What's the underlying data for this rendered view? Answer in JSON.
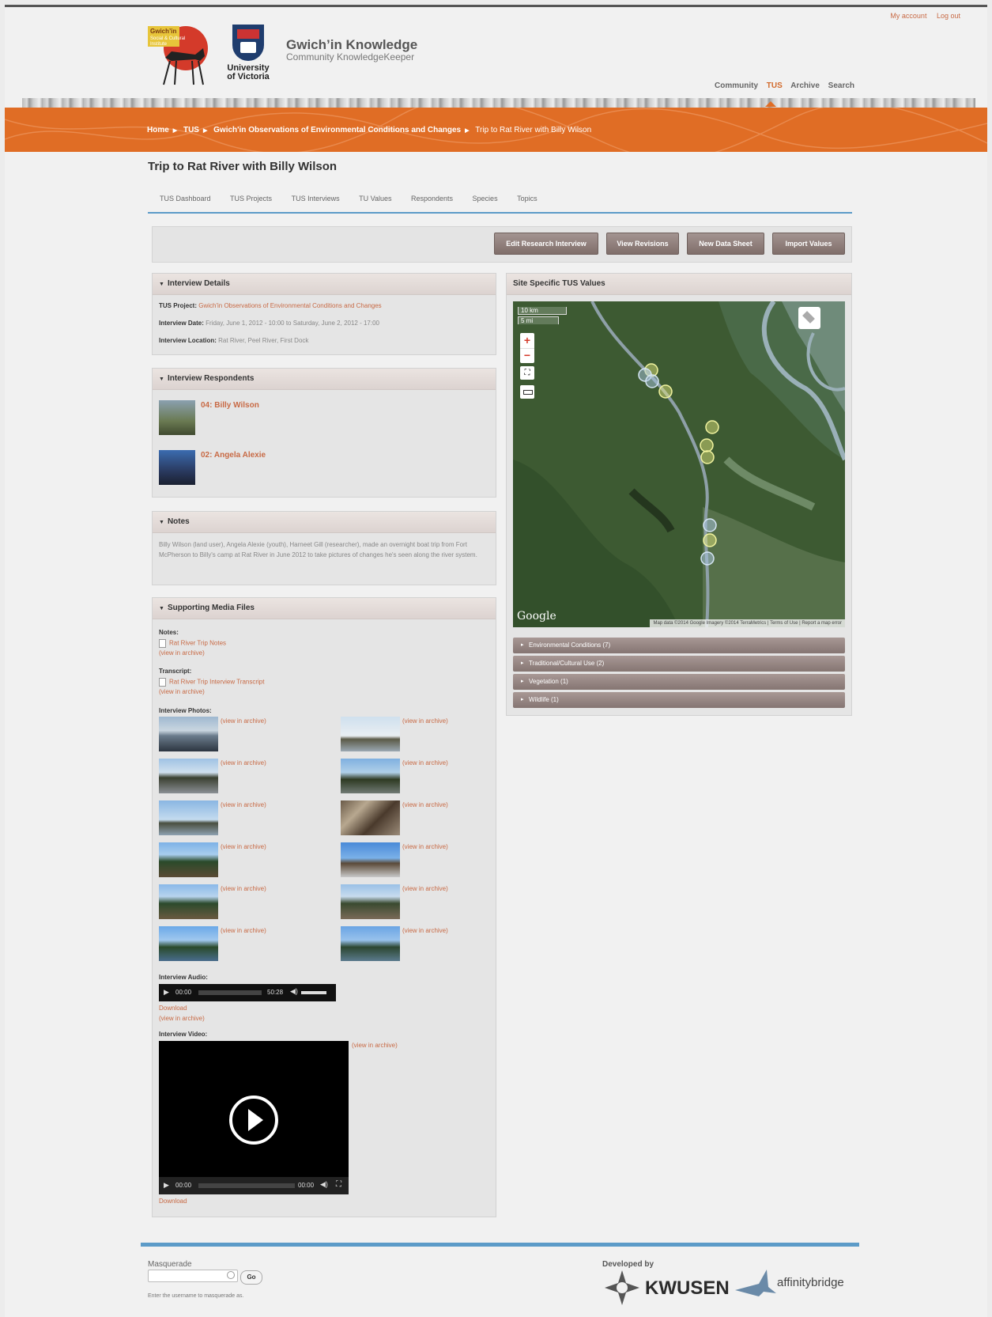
{
  "topbar": {
    "my_account": "My account",
    "log_out": "Log out"
  },
  "site": {
    "name": "Gwich’in Knowledge",
    "slogan": "Community KnowledgeKeeper",
    "uvic_line1": "University",
    "uvic_line2": "of Victoria",
    "logo_text_1": "Gwich’in",
    "logo_text_2": "Social & Cultural",
    "logo_text_3": "Institute"
  },
  "mainnav": [
    {
      "label": "Community"
    },
    {
      "label": "TUS"
    },
    {
      "label": "Archive"
    },
    {
      "label": "Search"
    }
  ],
  "breadcrumb": [
    "Home",
    "TUS",
    "Gwich'in Observations of Environmental Conditions and Changes",
    "Trip to Rat River with Billy Wilson"
  ],
  "page_title": "Trip to Rat River with Billy Wilson",
  "tabs": [
    "TUS Dashboard",
    "TUS Projects",
    "TUS Interviews",
    "TU Values",
    "Respondents",
    "Species",
    "Topics"
  ],
  "actions": [
    "Edit Research Interview",
    "View Revisions",
    "New Data Sheet",
    "Import Values"
  ],
  "interview_details": {
    "title": "Interview Details",
    "project_label": "TUS Project:",
    "project_value": "Gwich'in Observations of Environmental Conditions and Changes",
    "date_label": "Interview Date:",
    "date_value": "Friday, June 1, 2012 - 10:00 to Saturday, June 2, 2012 - 17:00",
    "location_label": "Interview Location:",
    "location_value": "Rat River, Peel River, First Dock"
  },
  "respondents": {
    "title": "Interview Respondents",
    "items": [
      "04: Billy Wilson",
      "02: Angela Alexie"
    ]
  },
  "notes": {
    "title": "Notes",
    "text": "Billy Wilson (land user), Angela Alexie (youth), Harneet Gill (researcher), made an overnight boat trip from Fort McPherson to Billy's camp at Rat River in June 2012 to take pictures of changes he's seen along the river system."
  },
  "media": {
    "title": "Supporting Media Files",
    "notes_label": "Notes:",
    "notes_file": "Rat River Trip Notes",
    "transcript_label": "Transcript:",
    "transcript_file": "Rat River Trip Interview Transcript",
    "view_in_archive": "(view in archive)",
    "photos_label": "Interview Photos:",
    "audio_label": "Interview Audio:",
    "audio_time": "00:00",
    "audio_duration": "50:28",
    "download": "Download",
    "video_label": "Interview Video:",
    "video_time": "00:00",
    "video_duration": "00:00"
  },
  "site_values": {
    "title": "Site Specific TUS Values",
    "scale_km": "10 km",
    "scale_mi": "5 mi",
    "google": "Google",
    "attribution": "Map data ©2014 Google Imagery ©2014 TerraMetrics",
    "terms": "Terms of Use",
    "report": "Report a map error",
    "categories": [
      "Environmental Conditions (7)",
      "Traditional/Cultural Use (2)",
      "Vegetation (1)",
      "Wildlife (1)"
    ]
  },
  "footer": {
    "masquerade_label": "Masquerade",
    "go": "Go",
    "masquerade_help": "Enter the username to masquerade as.",
    "developed_by": "Developed by",
    "kwusen": "KWUSEN",
    "affinity": "affinitybridge"
  },
  "colors": {
    "accent": "#e06d25",
    "link": "#c86a45",
    "rule": "#5c9bc8",
    "button": "#8f7e7a"
  }
}
